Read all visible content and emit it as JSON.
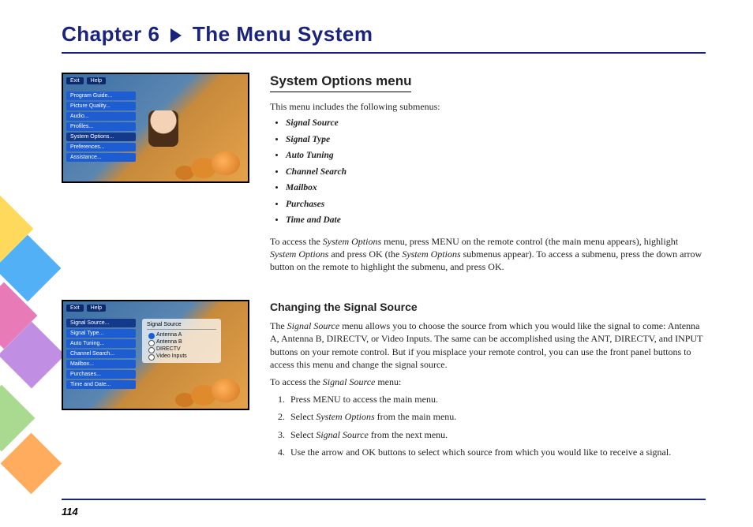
{
  "chapter": {
    "part1": "Chapter 6",
    "part2": "The Menu System"
  },
  "page_number": "114",
  "section1": {
    "title": "System Options menu",
    "intro": "This menu includes the following submenus:",
    "bullets": [
      "Signal Source",
      "Signal Type",
      "Auto Tuning",
      "Channel Search",
      "Mailbox",
      "Purchases",
      "Time and Date"
    ],
    "para_prefix": "To access the ",
    "para_ital1": "System Options",
    "para_mid1": " menu, press MENU on the remote control (the main menu appears), highlight ",
    "para_ital2": "System Options",
    "para_mid2": " and press OK (the ",
    "para_ital3": "System Options",
    "para_suffix": " submenus appear). To access a submenu, press the down arrow button on the remote to highlight the submenu, and press OK."
  },
  "thumb1": {
    "top": [
      "Exit",
      "Help"
    ],
    "menu": [
      "Program Guide...",
      "Picture Quality...",
      "Audio...",
      "Profiles...",
      "System Options...",
      "Preferences...",
      "Assistance..."
    ],
    "selected_index": 4
  },
  "section2": {
    "title": "Changing the Signal Source",
    "p1_prefix": "The ",
    "p1_ital": "Signal Source",
    "p1_suffix": " menu allows you to choose the source from which you would like the signal to come: Antenna A, Antenna B, DIRECTV, or Video Inputs. The same can be accomplished using the ANT, DIRECTV, and INPUT buttons on your remote control. But if you misplace your remote control, you can use the front panel buttons to access this menu and change the signal source.",
    "p2_prefix": "To access the ",
    "p2_ital": "Signal Source",
    "p2_suffix": " menu:",
    "steps": [
      {
        "text": "Press MENU to access the main menu."
      },
      {
        "pre": "Select ",
        "ital": "System Options",
        "post": " from the main menu."
      },
      {
        "pre": "Select ",
        "ital": "Signal Source",
        "post": " from the next menu."
      },
      {
        "text": "Use the arrow and OK buttons to select which source from which you would like to receive a signal."
      }
    ]
  },
  "thumb2": {
    "top": [
      "Exit",
      "Help"
    ],
    "menu": [
      "Signal Source...",
      "Signal Type...",
      "Auto Tuning...",
      "Channel Search...",
      "Mailbox...",
      "Purchases...",
      "Time and Date..."
    ],
    "selected_index": 0,
    "submenu": {
      "title": "Signal Source",
      "options": [
        "Antenna A",
        "Antenna B",
        "DIRECTV",
        "Video Inputs"
      ],
      "selected_index": 0
    }
  }
}
